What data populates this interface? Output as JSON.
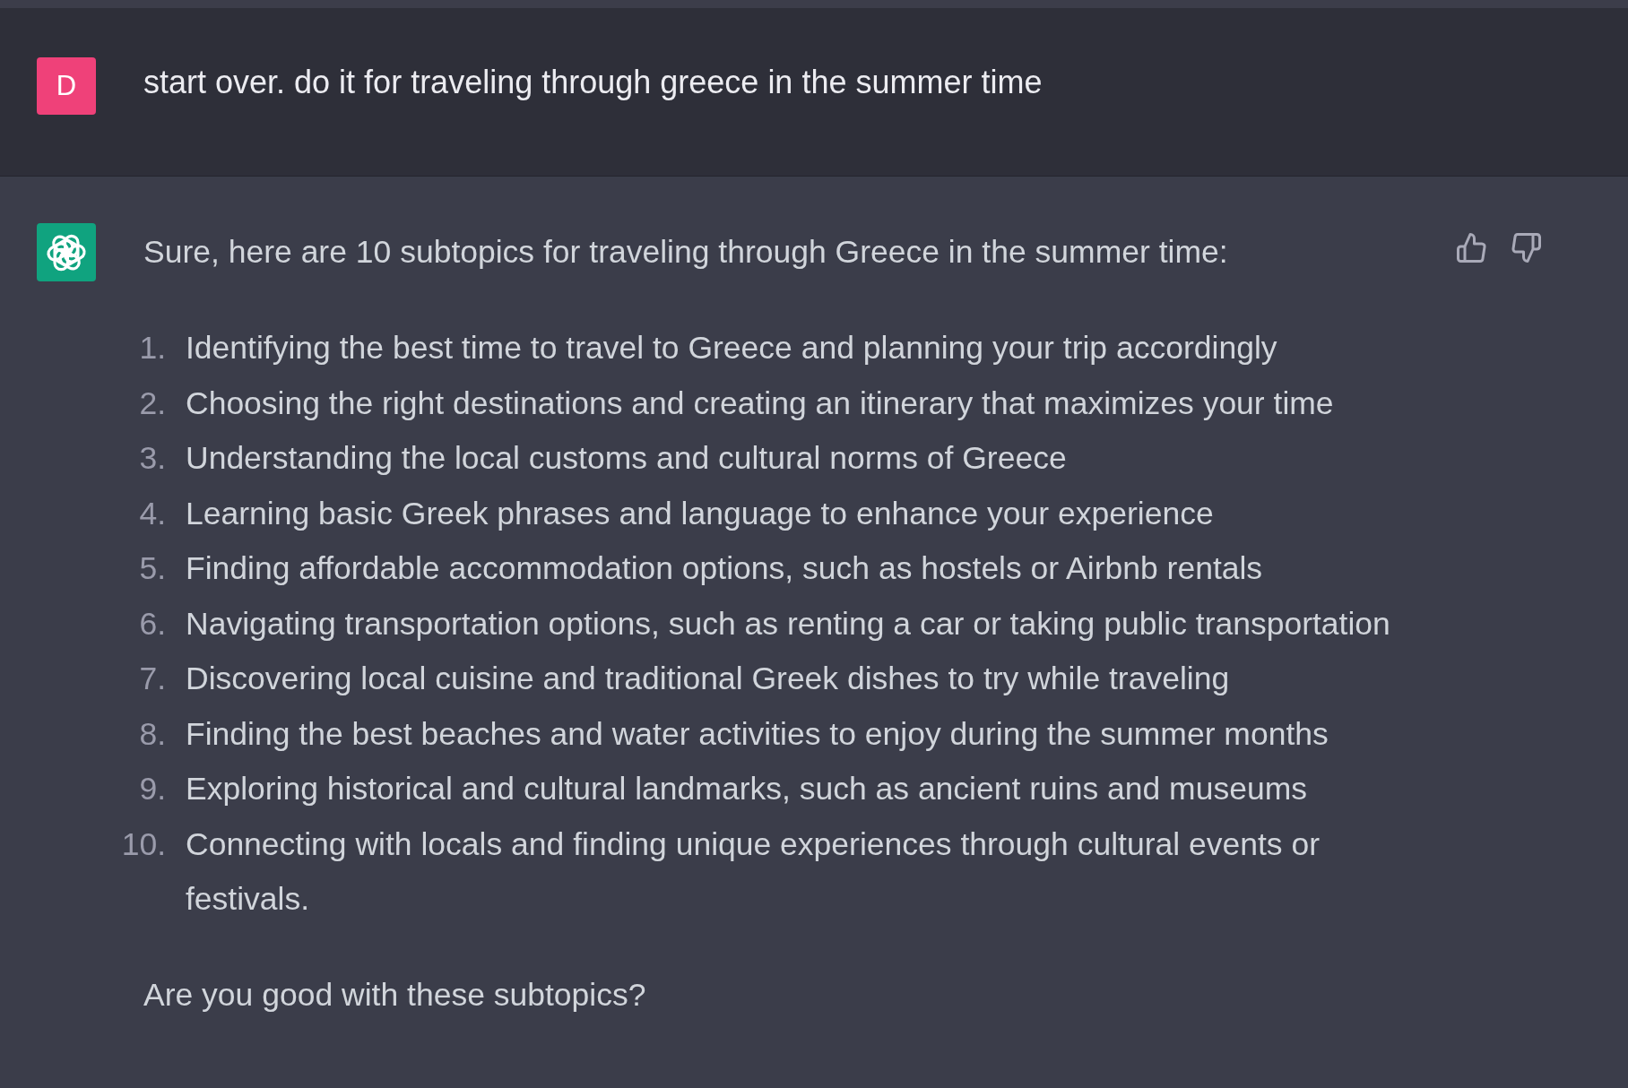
{
  "user_message": {
    "avatar_letter": "D",
    "text": "start over. do it for traveling through greece in the summer time"
  },
  "assistant_message": {
    "intro": "Sure, here are 10 subtopics for traveling through Greece in the summer time:",
    "list": [
      {
        "number": "1.",
        "text": "Identifying the best time to travel to Greece and planning your trip accordingly"
      },
      {
        "number": "2.",
        "text": "Choosing the right destinations and creating an itinerary that maximizes your time"
      },
      {
        "number": "3.",
        "text": "Understanding the local customs and cultural norms of Greece"
      },
      {
        "number": "4.",
        "text": "Learning basic Greek phrases and language to enhance your experience"
      },
      {
        "number": "5.",
        "text": "Finding affordable accommodation options, such as hostels or Airbnb rentals"
      },
      {
        "number": "6.",
        "text": "Navigating transportation options, such as renting a car or taking public transportation"
      },
      {
        "number": "7.",
        "text": "Discovering local cuisine and traditional Greek dishes to try while traveling"
      },
      {
        "number": "8.",
        "text": "Finding the best beaches and water activities to enjoy during the summer months"
      },
      {
        "number": "9.",
        "text": "Exploring historical and cultural landmarks, such as ancient ruins and museums"
      },
      {
        "number": "10.",
        "text": "Connecting with locals and finding unique experiences through cultural events or festivals."
      }
    ],
    "closing": "Are you good with these subtopics?"
  }
}
